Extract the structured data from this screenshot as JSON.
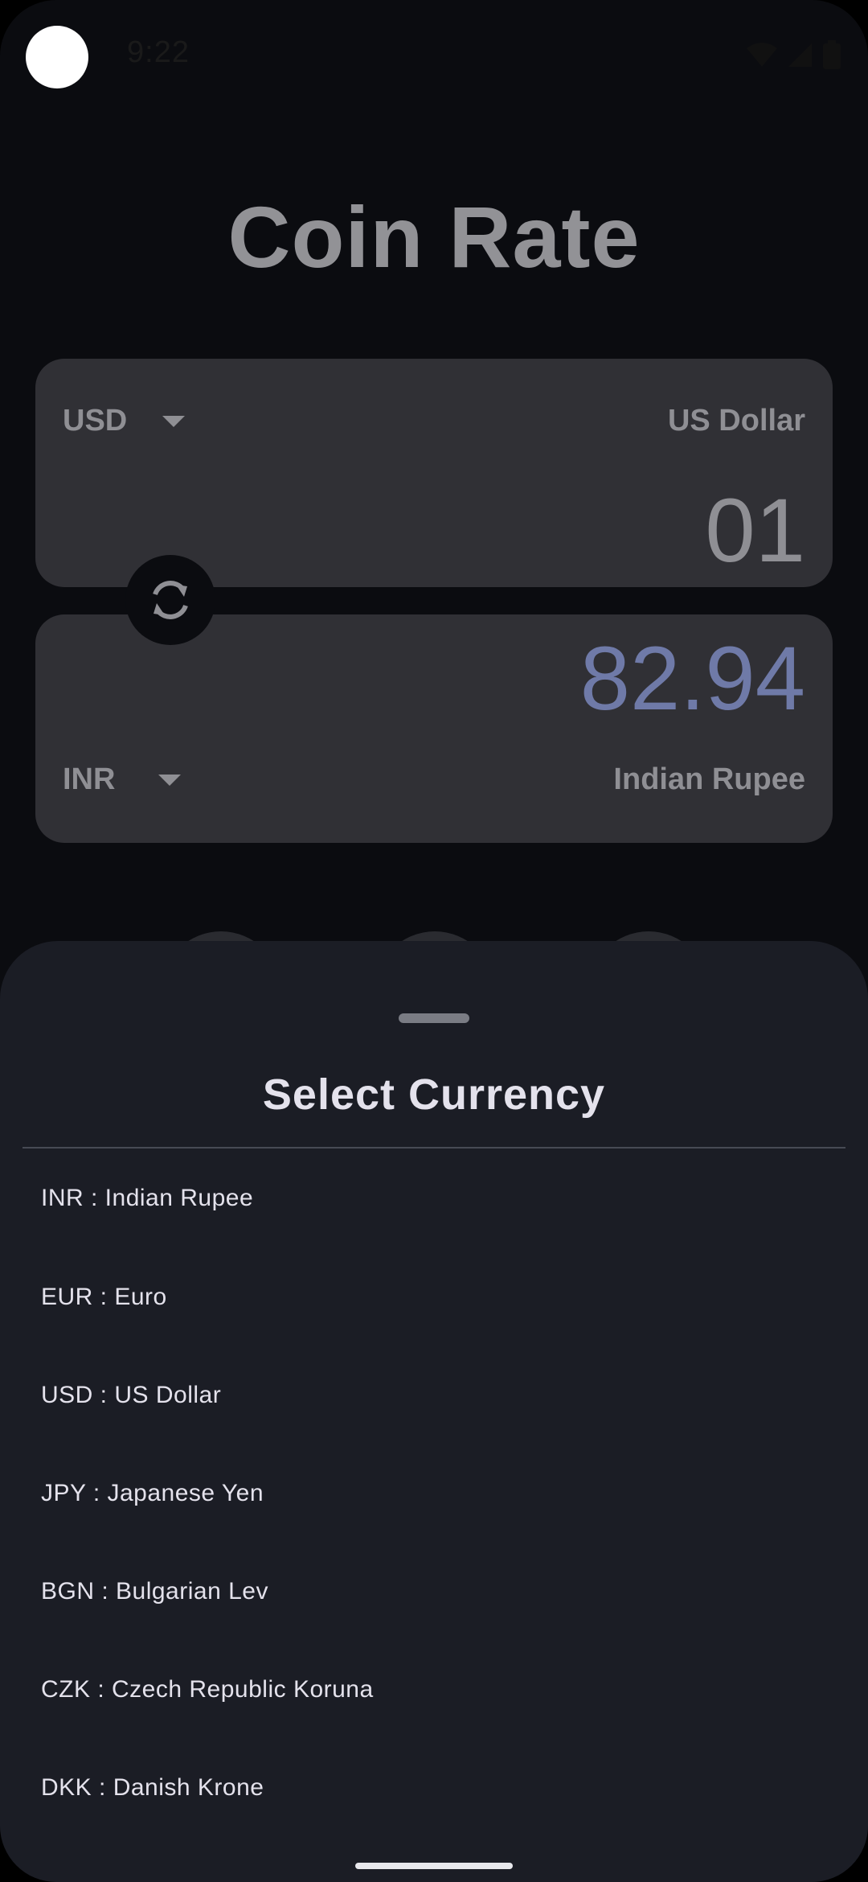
{
  "status_bar": {
    "time": "9:22",
    "icons": [
      "wifi-icon",
      "signal-icon",
      "battery-icon"
    ]
  },
  "app": {
    "title": "Coin Rate"
  },
  "converter": {
    "from": {
      "code": "USD",
      "name": "US Dollar",
      "amount": "01"
    },
    "to": {
      "code": "INR",
      "name": "Indian Rupee",
      "amount": "82.94"
    },
    "swap_icon": "swap-refresh-icon"
  },
  "sheet": {
    "title": "Select Currency",
    "items": [
      {
        "label": "INR : Indian Rupee"
      },
      {
        "label": "EUR : Euro"
      },
      {
        "label": "USD : US Dollar"
      },
      {
        "label": "JPY : Japanese Yen"
      },
      {
        "label": "BGN : Bulgarian Lev"
      },
      {
        "label": "CZK : Czech Republic Koruna"
      },
      {
        "label": "DKK : Danish Krone"
      }
    ]
  },
  "colors": {
    "background": "#0b0c10",
    "card": "#303035",
    "sheet": "#1b1d25",
    "muted_text": "#8f8f94",
    "result_accent": "#6f7aa8",
    "sheet_text": "#e4e2ec"
  }
}
